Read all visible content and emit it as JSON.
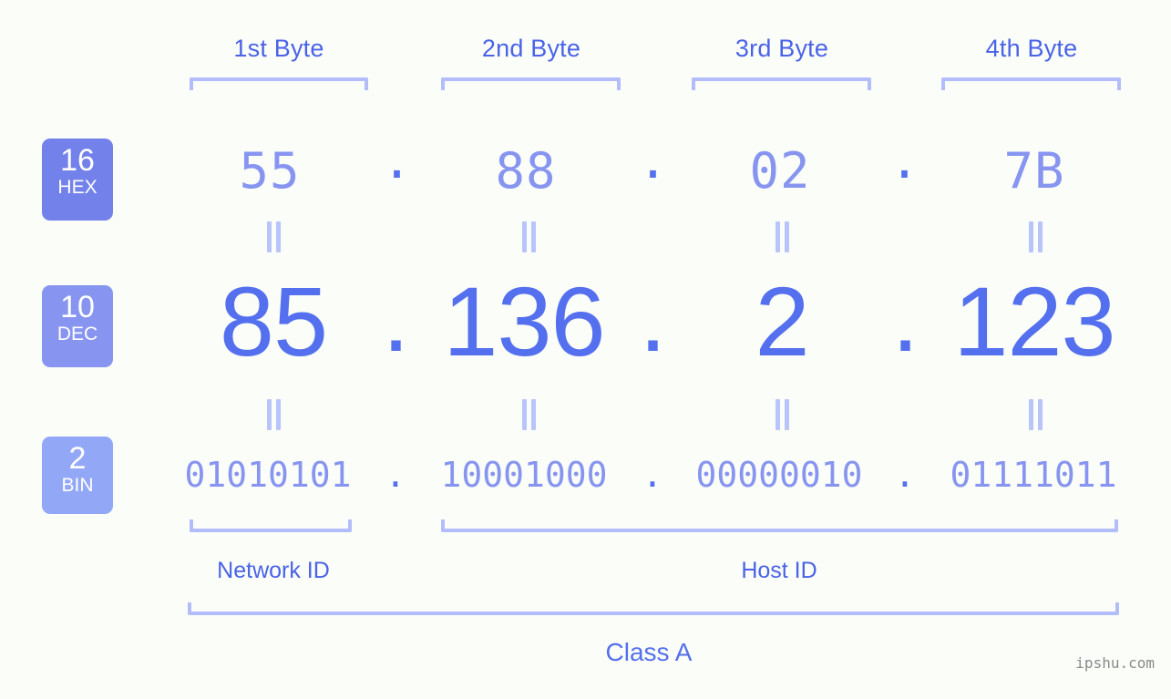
{
  "background_color": "#fafdf8",
  "accent_colors": {
    "label_blue": "#4a63e7",
    "dec_blue": "#5570ee",
    "hex_blue": "#8795f0",
    "bracket_blue": "#b3bdfb",
    "badge_hex": "#7381ea",
    "badge_dec": "#8795f0",
    "badge_bin": "#93a7f7"
  },
  "byte_headers": [
    {
      "label": "1st Byte"
    },
    {
      "label": "2nd Byte"
    },
    {
      "label": "3rd Byte"
    },
    {
      "label": "4th Byte"
    }
  ],
  "bases": [
    {
      "number": "16",
      "name": "HEX"
    },
    {
      "number": "10",
      "name": "DEC"
    },
    {
      "number": "2",
      "name": "BIN"
    }
  ],
  "separator": ".",
  "rows": {
    "hex": {
      "base_number": "16",
      "base_name": "HEX",
      "values": [
        "55",
        "88",
        "02",
        "7B"
      ]
    },
    "dec": {
      "base_number": "10",
      "base_name": "DEC",
      "values": [
        "85",
        "136",
        "2",
        "123"
      ]
    },
    "bin": {
      "base_number": "2",
      "base_name": "BIN",
      "values": [
        "01010101",
        "10001000",
        "00000010",
        "01111011"
      ]
    }
  },
  "segments": {
    "network_id": "Network ID",
    "host_id": "Host ID",
    "class": "Class A"
  },
  "watermark": "ipshu.com"
}
